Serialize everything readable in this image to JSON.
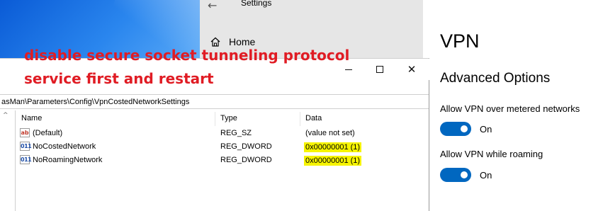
{
  "settings": {
    "back_glyph": "←",
    "title": "Settings",
    "home_label": "Home",
    "page_heading": "VPN",
    "section_heading": "Advanced Options",
    "options": [
      {
        "label": "Allow VPN over metered networks",
        "state": "On",
        "enabled": true
      },
      {
        "label": "Allow VPN while roaming",
        "state": "On",
        "enabled": true
      }
    ],
    "accent_color": "#0067c0"
  },
  "annotation": {
    "line1": "disable secure socket tunneling protocol",
    "line2": "service first and restart",
    "color": "#e01c24",
    "highlight_color": "#f6f400"
  },
  "regedit": {
    "address": "asMan\\Parameters\\Config\\VpnCostedNetworkSettings",
    "window_controls": {
      "close_glyph": "✕"
    },
    "tree_arrow": "^",
    "columns": {
      "name": "Name",
      "type": "Type",
      "data": "Data"
    },
    "rows": [
      {
        "icon": "string-value-icon",
        "icon_text": "ab",
        "name": "(Default)",
        "type": "REG_SZ",
        "data": "(value not set)",
        "highlighted": false
      },
      {
        "icon": "dword-value-icon",
        "icon_text": "011",
        "name": "NoCostedNetwork",
        "type": "REG_DWORD",
        "data": "0x00000001 (1)",
        "highlighted": true
      },
      {
        "icon": "dword-value-icon",
        "icon_text": "011",
        "name": "NoRoamingNetwork",
        "type": "REG_DWORD",
        "data": "0x00000001 (1)",
        "highlighted": true
      }
    ]
  }
}
